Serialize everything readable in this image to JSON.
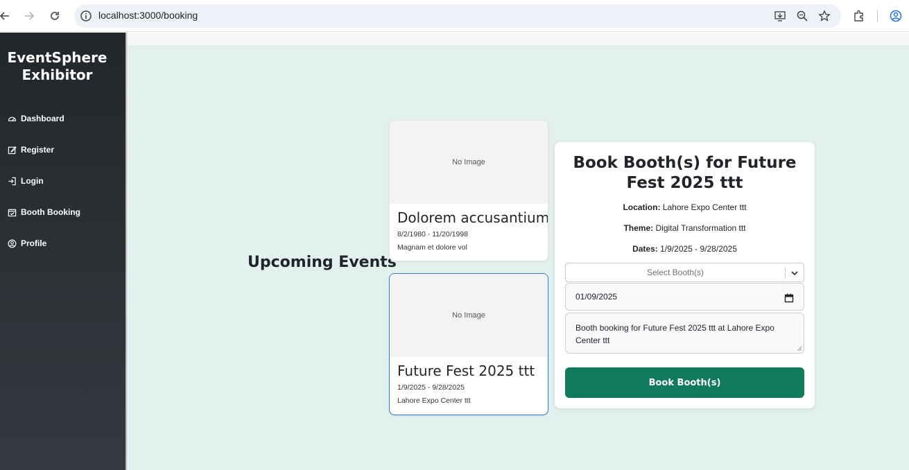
{
  "browser": {
    "url": "localhost:3000/booking"
  },
  "sidebar": {
    "brand_line1": "EventSphere",
    "brand_line2": "Exhibitor",
    "items": [
      {
        "label": "Dashboard",
        "icon": "speedometer-icon"
      },
      {
        "label": "Register",
        "icon": "edit-icon"
      },
      {
        "label": "Login",
        "icon": "login-icon"
      },
      {
        "label": "Booth Booking",
        "icon": "calendar-check-icon"
      },
      {
        "label": "Profile",
        "icon": "user-circle-icon"
      }
    ]
  },
  "main": {
    "heading": "Upcoming Events",
    "events": [
      {
        "image_text": "No Image",
        "title": "Dolorem accusantium",
        "dates": "8/2/1980 - 11/20/1998",
        "subtitle": "Magnam et dolore vol"
      },
      {
        "image_text": "No Image",
        "title": "Future Fest 2025 ttt",
        "dates": "1/9/2025 - 9/28/2025",
        "subtitle": "Lahore Expo Center ttt"
      }
    ]
  },
  "booking": {
    "title": "Book Booth(s) for Future Fest 2025 ttt",
    "location_label": "Location:",
    "location_value": "Lahore Expo Center ttt",
    "theme_label": "Theme:",
    "theme_value": "Digital Transformation ttt",
    "dates_label": "Dates:",
    "dates_value": "1/9/2025 - 9/28/2025",
    "select_placeholder": "Select Booth(s)",
    "date_value": "01/09/2025",
    "notes_value": "Booth booking for Future Fest 2025 ttt at Lahore Expo Center ttt",
    "submit_label": "Book Booth(s)"
  },
  "colors": {
    "sidebar_bg": "#23272b",
    "main_bg": "#e2f1ee",
    "primary_button": "#117a5b",
    "selected_border": "#2f7fd6"
  }
}
